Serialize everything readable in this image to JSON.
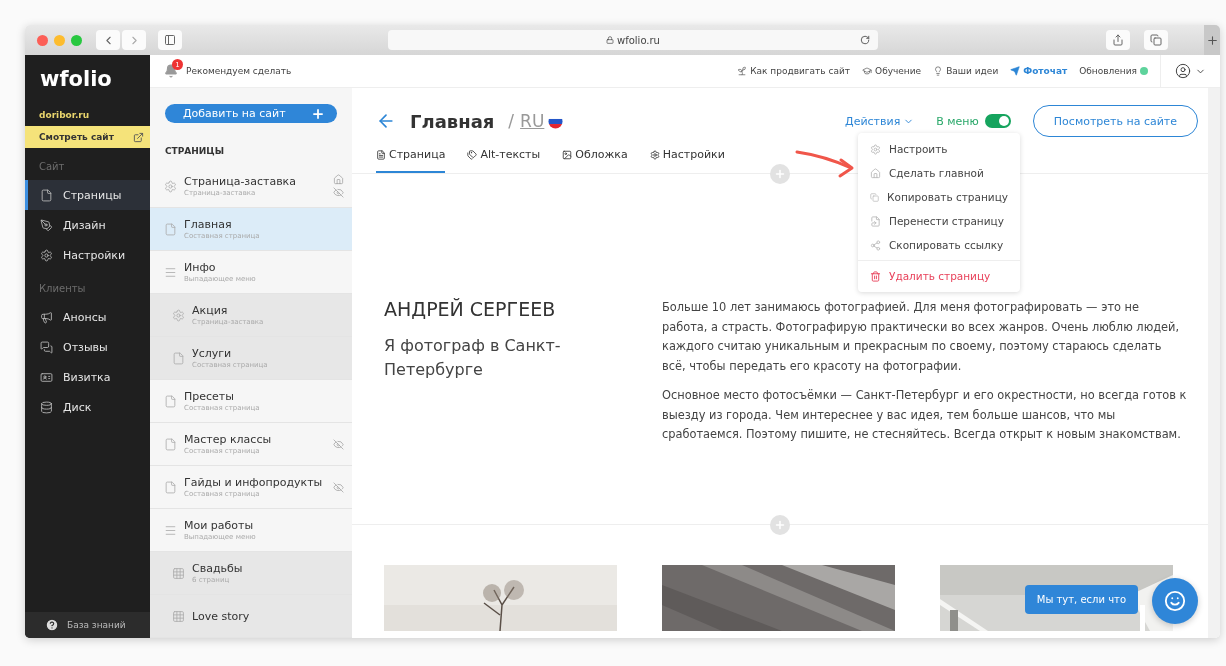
{
  "browser": {
    "address": "wfolio.ru"
  },
  "sidebar": {
    "logo": "wfolio",
    "domain": "doribor.ru",
    "view_site": "Смотреть сайт",
    "sections": [
      {
        "label": "Сайт",
        "items": [
          {
            "label": "Страницы",
            "selected": true
          },
          {
            "label": "Дизайн",
            "selected": false
          },
          {
            "label": "Настройки",
            "selected": false
          }
        ]
      },
      {
        "label": "Клиенты",
        "items": [
          {
            "label": "Анонсы",
            "selected": false
          },
          {
            "label": "Отзывы",
            "selected": false
          },
          {
            "label": "Визитка",
            "selected": false
          },
          {
            "label": "Диск",
            "selected": false
          }
        ]
      }
    ],
    "help": "База знаний"
  },
  "topbar": {
    "notifications": {
      "badge": "1",
      "label": "Рекомендуем сделать"
    },
    "links": [
      {
        "label": "Как продвигать сайт",
        "kind": "plain"
      },
      {
        "label": "Обучение",
        "kind": "plain"
      },
      {
        "label": "Ваши идеи",
        "kind": "plain"
      },
      {
        "label": "Фоточат",
        "kind": "accent"
      },
      {
        "label": "Обновления",
        "kind": "status"
      }
    ]
  },
  "pages_panel": {
    "add_button": "Добавить на сайт",
    "heading": "СТРАНИЦЫ",
    "items": [
      {
        "title": "Страница-заставка",
        "subtitle": "Страница-заставка",
        "kind": "cover",
        "selected": false,
        "home": true,
        "hidden": true
      },
      {
        "title": "Главная",
        "subtitle": "Составная страница",
        "kind": "page",
        "selected": true,
        "home": false,
        "hidden": false
      },
      {
        "title": "Инфо",
        "subtitle": "Выпадающее меню",
        "kind": "menu",
        "selected": false,
        "home": false,
        "hidden": false,
        "children": [
          {
            "title": "Акция",
            "subtitle": "Страница-заставка",
            "kind": "cover",
            "selected": false,
            "home": false,
            "hidden": false
          },
          {
            "title": "Услуги",
            "subtitle": "Составная страница",
            "kind": "page",
            "selected": false,
            "home": false,
            "hidden": false
          }
        ]
      },
      {
        "title": "Пресеты",
        "subtitle": "Составная страница",
        "kind": "page",
        "selected": false,
        "home": false,
        "hidden": false
      },
      {
        "title": "Мастер классы",
        "subtitle": "Составная страница",
        "kind": "page",
        "selected": false,
        "home": false,
        "hidden": true
      },
      {
        "title": "Гайды и инфопродукты",
        "subtitle": "Составная страница",
        "kind": "page",
        "selected": false,
        "home": false,
        "hidden": true
      },
      {
        "title": "Мои работы",
        "subtitle": "Выпадающее меню",
        "kind": "menu",
        "selected": false,
        "home": false,
        "hidden": false,
        "children": [
          {
            "title": "Свадьбы",
            "subtitle": "6 страниц",
            "kind": "gallery",
            "selected": false,
            "home": false,
            "hidden": false
          },
          {
            "title": "Love story",
            "kind": "gallery",
            "selected": false,
            "home": false,
            "hidden": false
          }
        ]
      }
    ]
  },
  "editor": {
    "title": "Главная",
    "separator": "/",
    "language": "RU",
    "actions": "Действия",
    "in_menu": {
      "label": "В меню",
      "on": true
    },
    "view_button": "Посмотреть на сайте",
    "tabs": [
      {
        "label": "Страница",
        "selected": true
      },
      {
        "label": "Alt-тексты",
        "selected": false
      },
      {
        "label": "Обложка",
        "selected": false
      },
      {
        "label": "Настройки",
        "selected": false
      }
    ],
    "actions_menu": [
      {
        "label": "Настроить",
        "kind": "normal"
      },
      {
        "label": "Сделать главной",
        "kind": "normal"
      },
      {
        "label": "Копировать страницу",
        "kind": "normal"
      },
      {
        "label": "Перенести страницу",
        "kind": "normal"
      },
      {
        "label": "Скопировать ссылку",
        "kind": "normal"
      },
      {
        "label": "Удалить страницу",
        "kind": "danger"
      }
    ],
    "content": {
      "name": "АНДРЕЙ СЕРГЕЕВ",
      "tagline": "Я фотограф в Санкт-Петербурге",
      "paragraphs": [
        "Больше 10 лет занимаюсь фотографией. Для меня фотографировать — это не работа, а страсть. Фотографирую практически во всех жанров. Очень люблю людей, каждого считаю уникальным и прекрасным по своему, поэтому стараюсь сделать всё, чтобы передать его красоту на фотографии.",
        "Основное место фотосъёмки — Санкт-Петербург и его окрестности, но всегда готов к выезду из города. Чем интереснее у вас идея, тем больше шансов, что мы сработаемся. Поэтому пишите, не стесняйтесь. Всегда открыт к новым знакомствам."
      ]
    }
  },
  "chat": {
    "bubble": "Мы тут, если что"
  }
}
